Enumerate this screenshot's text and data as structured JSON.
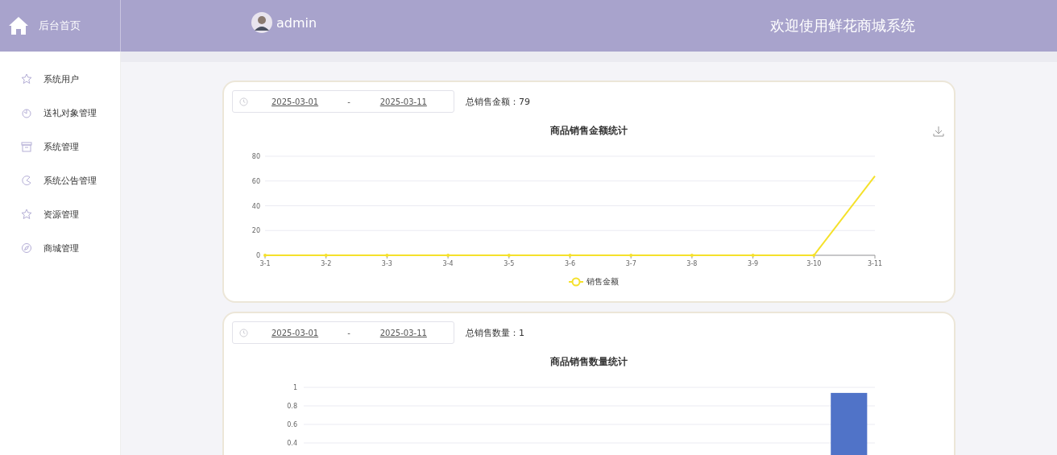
{
  "header": {
    "home_label": "后台首页",
    "user": "admin",
    "title": "欢迎使用鲜花商城系统"
  },
  "sidebar": {
    "items": [
      {
        "label": "系统用户",
        "kind": "star"
      },
      {
        "label": "送礼对象管理",
        "kind": "clock"
      },
      {
        "label": "系统管理",
        "kind": "box"
      },
      {
        "label": "系统公告管理",
        "kind": "pie"
      },
      {
        "label": "资源管理",
        "kind": "star"
      },
      {
        "label": "商城管理",
        "kind": "compass"
      }
    ]
  },
  "panels": [
    {
      "start_date": "2025-03-01",
      "separator": "-",
      "end_date": "2025-03-11",
      "total_label": "总销售金额：",
      "total": "79",
      "chart_data": {
        "type": "line",
        "title": "商品销售金额统计",
        "categories": [
          "3-1",
          "3-2",
          "3-3",
          "3-4",
          "3-5",
          "3-6",
          "3-7",
          "3-8",
          "3-9",
          "3-10",
          "3-11"
        ],
        "series": [
          {
            "name": "销售金额",
            "color": "#f5e12b",
            "values": [
              0,
              0,
              0,
              0,
              0,
              0,
              0,
              0,
              0,
              0,
              64
            ]
          }
        ],
        "ylim": [
          0,
          80
        ],
        "yticks": [
          0,
          20,
          40,
          60,
          80
        ],
        "grid": true
      }
    },
    {
      "start_date": "2025-03-01",
      "separator": "-",
      "end_date": "2025-03-11",
      "total_label": "总销售数量：",
      "total": "1",
      "chart_data": {
        "type": "bar",
        "title": "商品销售数量统计",
        "series": [
          {
            "color": "#5073c8",
            "values": [
              0,
              0,
              0,
              0,
              0,
              0,
              0,
              0,
              0,
              0,
              0.94
            ]
          }
        ],
        "ylim": [
          0,
          1
        ],
        "yticks": [
          0.4,
          0.6,
          0.8,
          1
        ],
        "grid": true
      }
    }
  ]
}
